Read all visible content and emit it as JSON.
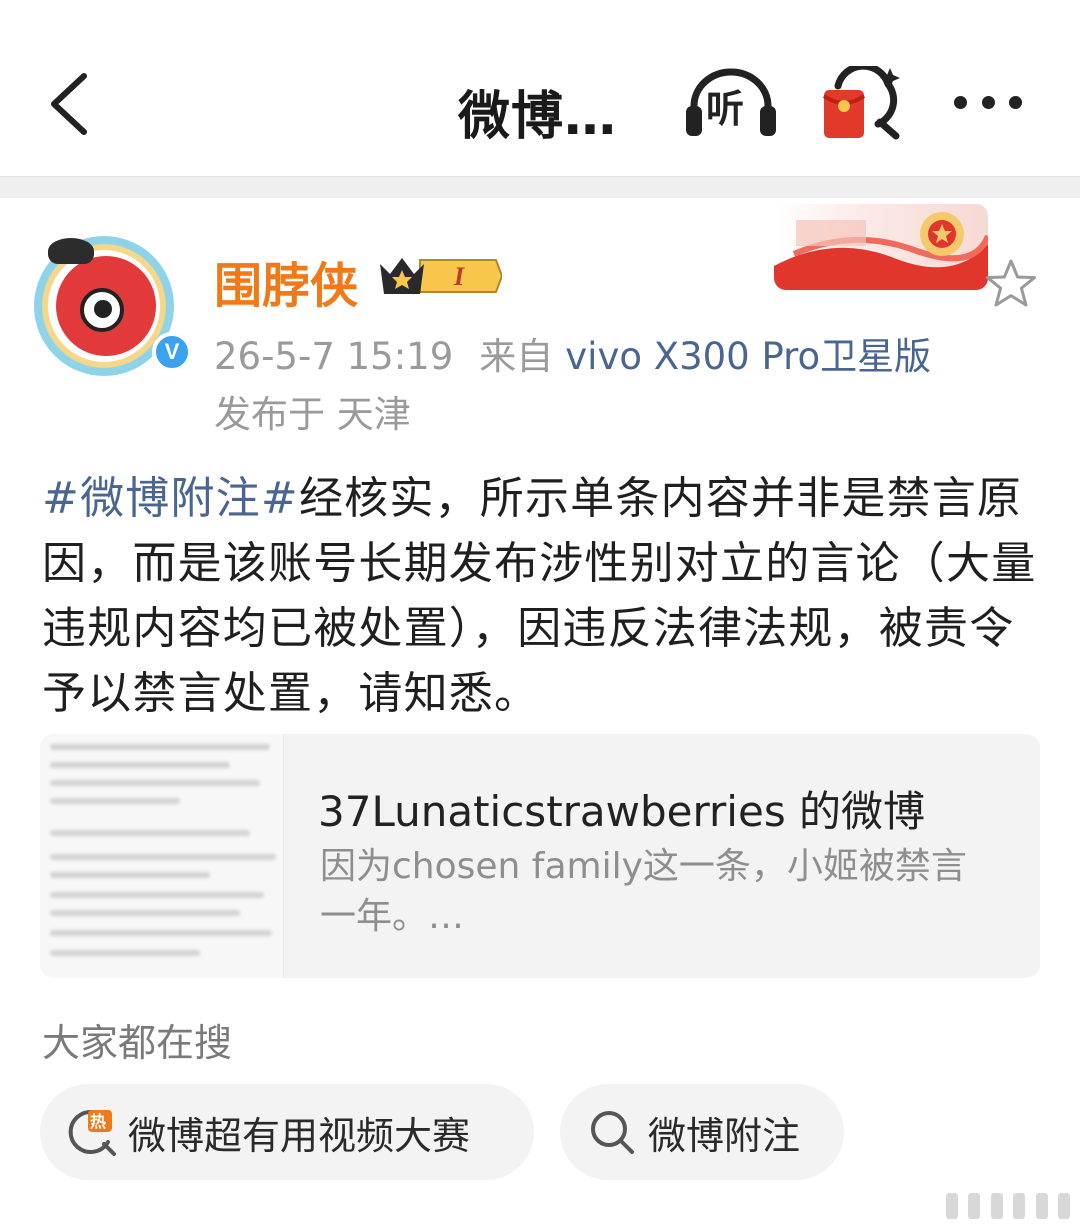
{
  "header": {
    "title": "微博…",
    "listen_label": "听",
    "colors": {
      "icon": "#222222",
      "redpack": "#e23a2a"
    }
  },
  "post": {
    "author": "围脖侠",
    "member_level": "I",
    "timestamp": "26-5-7 15:19",
    "source_prefix": "来自",
    "device": "vivo X300 Pro卫星版",
    "location": "发布于 天津",
    "text": {
      "hashtag": "#微博附注#",
      "body": "经核实，所示单条内容并非是禁言原因，而是该账号长期发布涉性别对立的言论（大量违规内容均已被处置），因违反法律法规，被责令予以禁言处置，请知悉。"
    },
    "colors": {
      "author": "#f07a1a",
      "link": "#4a6591",
      "meta": "#9a9a9a"
    }
  },
  "repost": {
    "title": "37Lunaticstrawberries 的微博",
    "snippet": "因为chosen family这一条，小姬被禁言一年。…"
  },
  "search": {
    "heading": "大家都在搜",
    "chips": [
      {
        "label": "微博超有用视频大赛",
        "icon": "hot-search-icon"
      },
      {
        "label": "微博附注",
        "icon": "search-icon"
      }
    ]
  }
}
